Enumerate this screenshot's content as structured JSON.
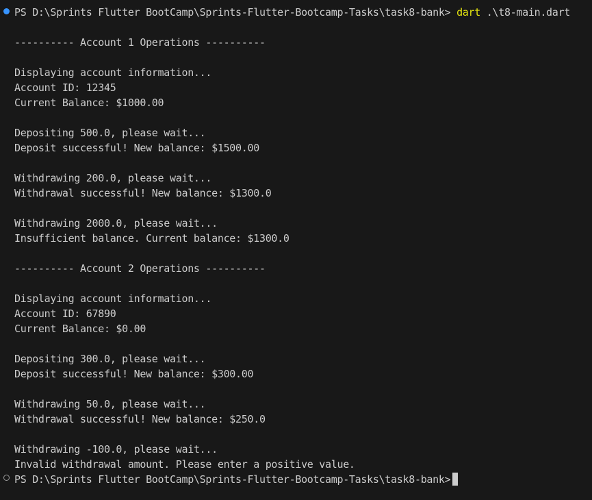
{
  "terminal": {
    "prompt": "PS D:\\Sprints Flutter BootCamp\\Sprints-Flutter-Bootcamp-Tasks\\task8-bank> ",
    "command": "dart",
    "command_args": " .\\t8-main.dart",
    "output": [
      "---------- Account 1 Operations ----------",
      "Displaying account information...",
      "Account ID: 12345",
      "Current Balance: $1000.00",
      "Depositing 500.0, please wait...",
      "Deposit successful! New balance: $1500.00",
      "Withdrawing 200.0, please wait...",
      "Withdrawal successful! New balance: $1300.0",
      "Withdrawing 2000.0, please wait...",
      "Insufficient balance. Current balance: $1300.0",
      "---------- Account 2 Operations ----------",
      "Displaying account information...",
      "Account ID: 67890",
      "Current Balance: $0.00",
      "Depositing 300.0, please wait...",
      "Deposit successful! New balance: $300.00",
      "Withdrawing 50.0, please wait...",
      "Withdrawal successful! New balance: $250.0",
      "Withdrawing -100.0, please wait...",
      "Invalid withdrawal amount. Please enter a positive value."
    ],
    "final_prompt": "PS D:\\Sprints Flutter BootCamp\\Sprints-Flutter-Bootcamp-Tasks\\task8-bank>",
    "colors": {
      "background": "#181818",
      "foreground": "#cccccc",
      "command": "#e5e510",
      "decoration_success": "#3794ff",
      "decoration_pending": "#9a9a9a"
    }
  }
}
